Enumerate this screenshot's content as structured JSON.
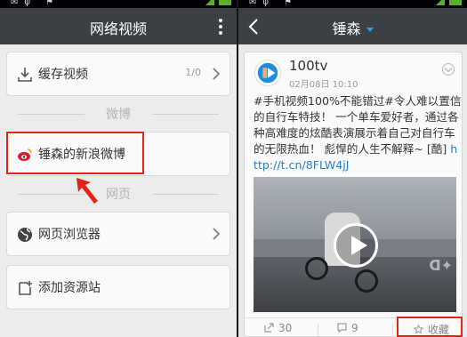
{
  "left": {
    "title": "网络视频",
    "cache_row": {
      "label": "缓存视频",
      "count": "1/0"
    },
    "section_weibo": "微博",
    "weibo_row": {
      "label": "锤森的新浪微博"
    },
    "section_web": "网页",
    "browser_row": {
      "label": "网页浏览器"
    },
    "add_row": {
      "label": "添加资源站"
    }
  },
  "right": {
    "title": "锤森",
    "post": {
      "author": "100tv",
      "time": "02月08日 10:10",
      "text": "#手机视频100%不能错过#令人难以置信的自行车特技！ 一个单车爱好者，通过各种高难度的炫酷表演展示着自己对自行车的无限热血！ 彪悍的人生不解释~ [酷] ",
      "link": "http://t.cn/8FLW4jJ",
      "share_count": "30",
      "comment_count": "9",
      "favorite_label": "收藏"
    }
  },
  "colors": {
    "titlebar": "#3c3f44",
    "highlight": "#e2231a",
    "link": "#2380c7",
    "battery": "#5ab02a"
  },
  "icons": [
    "download-icon",
    "weibo-icon",
    "globe-icon",
    "add-source-icon",
    "chevron-right-icon",
    "back-icon",
    "more-icon",
    "play-icon",
    "share-icon",
    "comment-icon",
    "star-icon"
  ]
}
